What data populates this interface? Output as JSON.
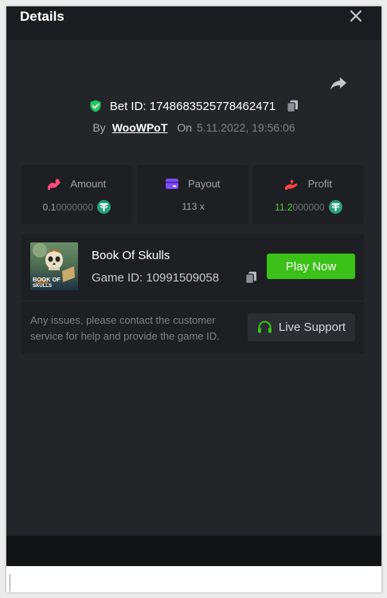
{
  "modal": {
    "title": "Details",
    "close_icon": "close-icon",
    "share_icon": "share-icon"
  },
  "bet": {
    "id_label": "Bet ID: 1748683525778462471",
    "by_label": "By",
    "username": "WooWPoT",
    "on_label": "On",
    "date": "5.11.2022, 19:56:06"
  },
  "stats": {
    "amount": {
      "label": "Amount",
      "value_main": "0.1",
      "value_dim": "0000000",
      "icon": "amount-hand-icon",
      "coin_icon": "tether-coin-icon"
    },
    "payout": {
      "label": "Payout",
      "value": "113 x",
      "icon": "wallet-card-icon"
    },
    "profit": {
      "label": "Profit",
      "value_main": "11.2",
      "value_dim": "000000",
      "icon": "profit-hand-icon",
      "coin_icon": "tether-coin-icon"
    }
  },
  "game": {
    "name": "Book Of Skulls",
    "game_id_label": "Game ID: 10991509058",
    "thumb_text_1": "BOOK OF",
    "thumb_text_2": "SKULLS",
    "play_label": "Play Now",
    "help_text": "Any issues, please contact the customer service for help and provide the game ID.",
    "support_label": "Live Support"
  },
  "colors": {
    "accent_green": "#3bc117",
    "profit_green": "#4cd137",
    "shield_green": "#22c55e",
    "amount_pink": "#ff4d7a",
    "payout_purple": "#7c4dff",
    "profit_red": "#ff4545",
    "coin_teal": "#26a17b"
  }
}
